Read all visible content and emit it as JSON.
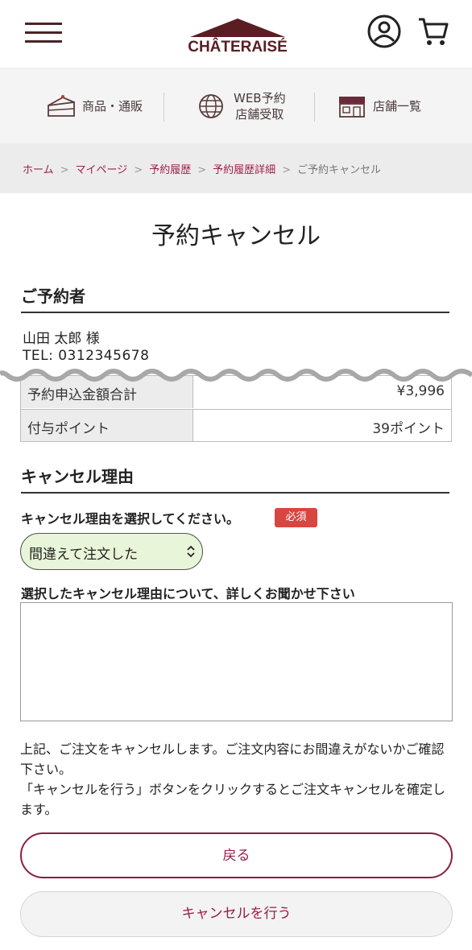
{
  "header": {
    "logo_text": "CHÂTERAISÉ",
    "brand_color": "#5a1e22"
  },
  "nav": {
    "items": [
      {
        "label": "商品・通販",
        "icon": "cake-icon"
      },
      {
        "label_line1": "WEB予約",
        "label_line2": "店舗受取",
        "icon": "globe-icon"
      },
      {
        "label": "店舗一覧",
        "icon": "store-icon"
      }
    ]
  },
  "breadcrumb": {
    "items": [
      "ホーム",
      "マイページ",
      "予約履歴",
      "予約履歴詳細"
    ],
    "separator": ">",
    "current": "ご予約キャンセル"
  },
  "page_title": "予約キャンセル",
  "reserver": {
    "heading": "ご予約者",
    "name": "山田 太郎 様",
    "tel": "TEL: 0312345678"
  },
  "summary_table": {
    "rows": [
      {
        "label": "予約申込金額合計",
        "value": "¥3,996"
      },
      {
        "label": "付与ポイント",
        "value": "39ポイント"
      }
    ]
  },
  "cancel_reason": {
    "heading": "キャンセル理由",
    "question": "キャンセル理由を選択してください。",
    "required_badge": "必須",
    "selected": "間違えて注文した",
    "detail_label": "選択したキャンセル理由について、詳しくお聞かせ下さい",
    "detail_value": ""
  },
  "notice": {
    "line1": "上記、ご注文をキャンセルします。ご注文内容にお間違えがないかご確認下さい。",
    "line2": "「キャンセルを行う」ボタンをクリックするとご注文キャンセルを確定します。"
  },
  "buttons": {
    "back": "戻る",
    "cancel": "キャンセルを行う"
  },
  "colors": {
    "accent": "#9b1c47",
    "badge": "#d9453f",
    "select_bg": "#e9f5d8"
  }
}
